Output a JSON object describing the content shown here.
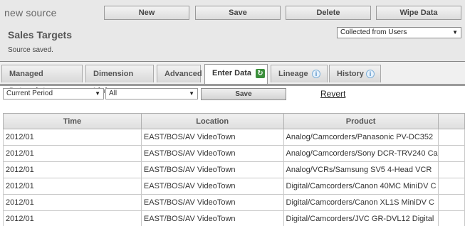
{
  "app": {
    "title": "new source"
  },
  "toolbar": {
    "new_label": "New",
    "save_label": "Save",
    "delete_label": "Delete",
    "wipe_label": "Wipe Data"
  },
  "source": {
    "name": "Sales Targets",
    "status": "Source saved.",
    "type_select": "Collected from Users"
  },
  "tabs": [
    {
      "label": "Managed Datapoints"
    },
    {
      "label": "Dimension Links"
    },
    {
      "label": "Advanced"
    },
    {
      "label": "Enter Data",
      "active": true,
      "icon": "refresh-icon"
    },
    {
      "label": "Lineage",
      "icon": "info-icon"
    },
    {
      "label": "History",
      "icon": "info-icon"
    }
  ],
  "controls": {
    "period_select": "Current Period",
    "filter_select": "All",
    "save_label": "Save",
    "revert_label": "Revert"
  },
  "table": {
    "columns": [
      "Time",
      "Location",
      "Product",
      ""
    ],
    "rows": [
      [
        "2012/01",
        "EAST/BOS/AV VideoTown",
        "Analog/Camcorders/Panasonic PV-DC352",
        ""
      ],
      [
        "2012/01",
        "EAST/BOS/AV VideoTown",
        "Analog/Camcorders/Sony DCR-TRV240 Ca",
        ""
      ],
      [
        "2012/01",
        "EAST/BOS/AV VideoTown",
        "Analog/VCRs/Samsung SV5 4-Head VCR",
        ""
      ],
      [
        "2012/01",
        "EAST/BOS/AV VideoTown",
        "Digital/Camcorders/Canon 40MC MiniDV C",
        ""
      ],
      [
        "2012/01",
        "EAST/BOS/AV VideoTown",
        "Digital/Camcorders/Canon XL1S MiniDV C",
        ""
      ],
      [
        "2012/01",
        "EAST/BOS/AV VideoTown",
        "Digital/Camcorders/JVC GR-DVL12 Digital",
        ""
      ]
    ]
  }
}
